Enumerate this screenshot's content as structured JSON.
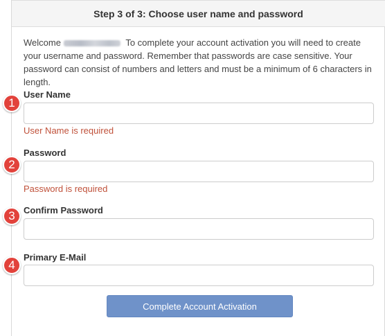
{
  "header": {
    "title": "Step 3 of 3: Choose user name and password"
  },
  "intro": {
    "welcome": "Welcome",
    "text": "To complete your account activation you will need to create your username and password. Remember that passwords are case sensitive. Your password can consist of numbers and letters and must be a minimum of 6 characters in length."
  },
  "fields": {
    "username": {
      "label": "User Name",
      "value": "",
      "error": "User Name is required",
      "marker": "1"
    },
    "password": {
      "label": "Password",
      "value": "",
      "error": "Password is required",
      "marker": "2"
    },
    "confirm_password": {
      "label": "Confirm Password",
      "value": "",
      "marker": "3"
    },
    "email": {
      "label": "Primary E-Mail",
      "value": "",
      "marker": "4"
    }
  },
  "actions": {
    "submit_label": "Complete Account Activation"
  },
  "colors": {
    "error": "#c0513a",
    "button": "#6f92c9",
    "marker": "#e2423b"
  }
}
